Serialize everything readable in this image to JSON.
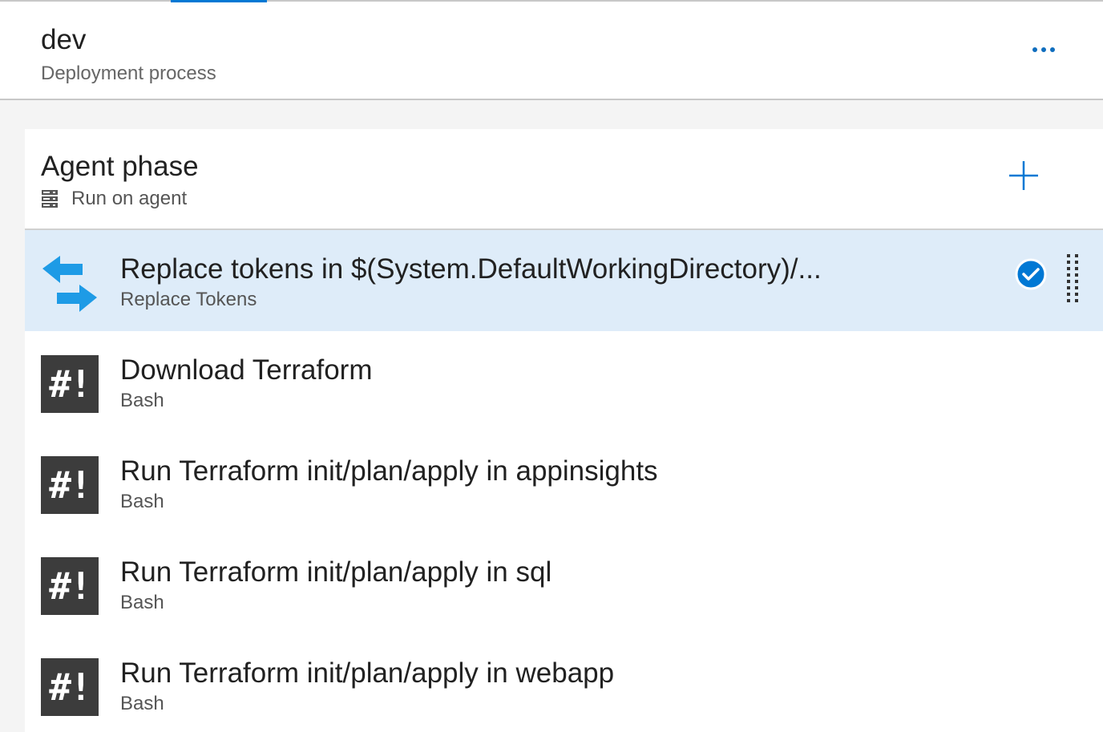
{
  "header": {
    "title": "dev",
    "subtitle": "Deployment process",
    "more_icon": "ellipsis-icon"
  },
  "phase": {
    "title": "Agent phase",
    "subtitle": "Run on agent",
    "subtitle_icon": "server-icon",
    "add_icon": "plus-icon"
  },
  "tasks": [
    {
      "name": "Replace tokens in $(System.DefaultWorkingDirectory)/...",
      "type": "Replace Tokens",
      "icon": "replace-tokens-icon",
      "selected": true,
      "enabled": true
    },
    {
      "name": "Download Terraform",
      "type": "Bash",
      "icon": "bash-icon",
      "icon_text": "#!"
    },
    {
      "name": "Run Terraform init/plan/apply in appinsights",
      "type": "Bash",
      "icon": "bash-icon",
      "icon_text": "#!"
    },
    {
      "name": "Run Terraform init/plan/apply in sql",
      "type": "Bash",
      "icon": "bash-icon",
      "icon_text": "#!"
    },
    {
      "name": "Run Terraform init/plan/apply in webapp",
      "type": "Bash",
      "icon": "bash-icon",
      "icon_text": "#!"
    }
  ],
  "colors": {
    "accent": "#0078d4",
    "selected_row": "#deecf9",
    "bash_icon_bg": "#3c3c3c",
    "replace_icon": "#1e9be6"
  }
}
